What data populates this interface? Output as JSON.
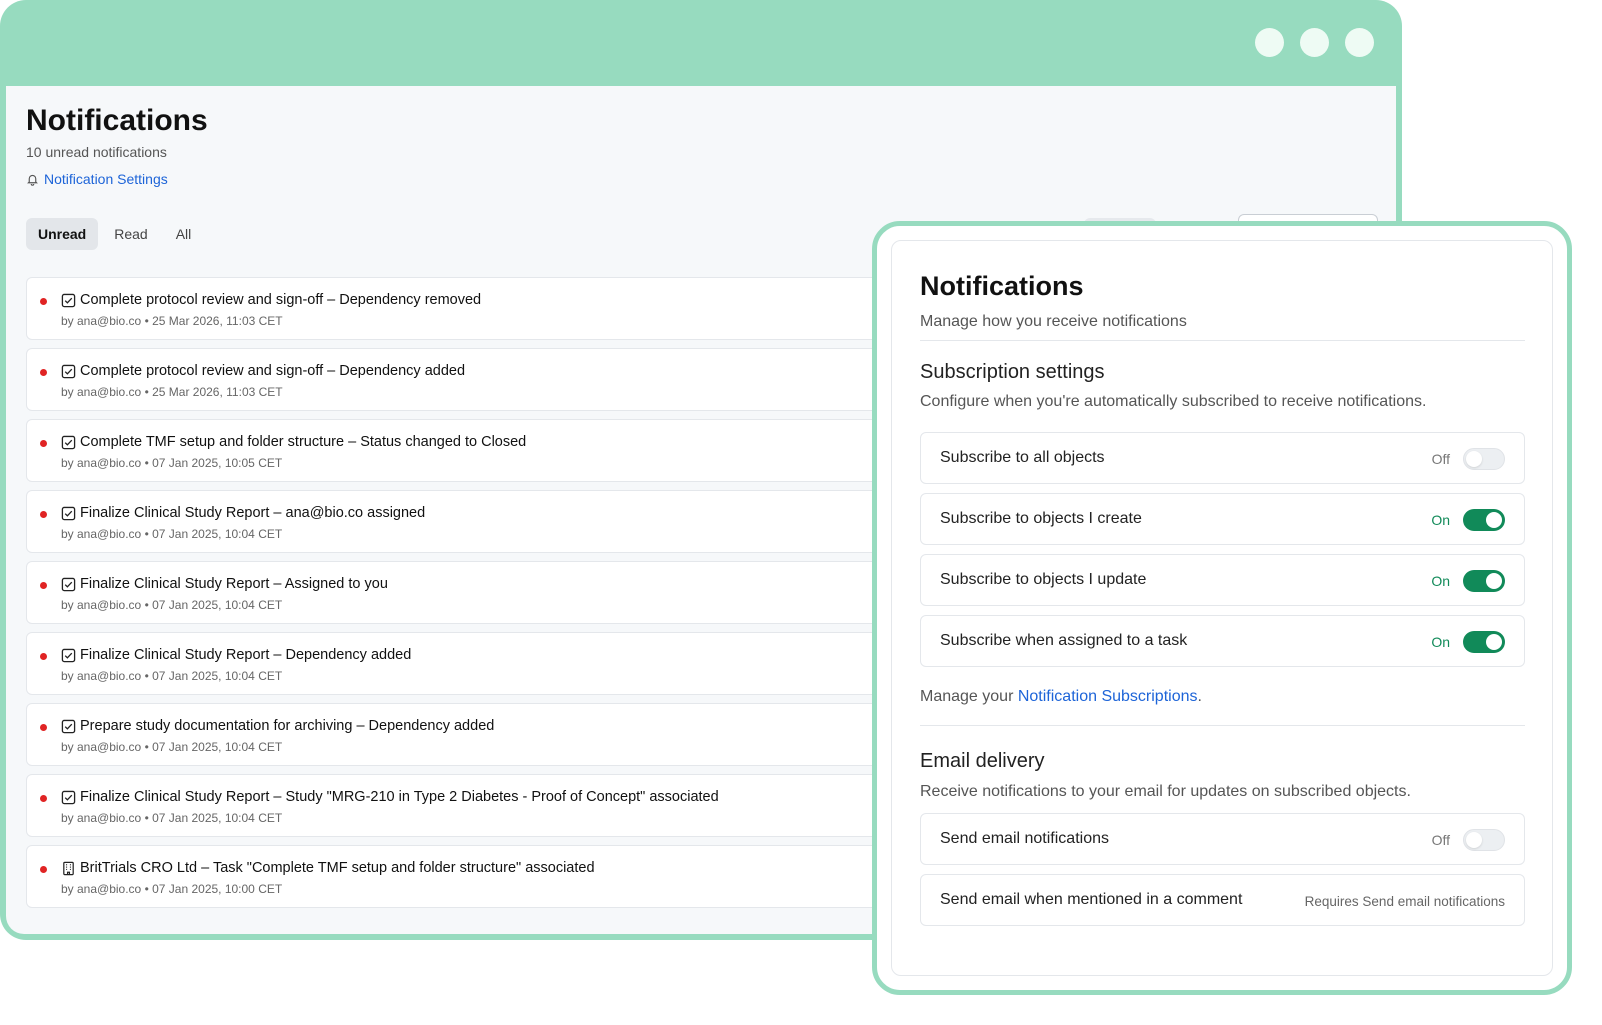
{
  "notifications_page": {
    "title": "Notifications",
    "unread_count_text": "10 unread notifications",
    "settings_link": "Notification Settings",
    "tabs": [
      {
        "label": "Unread"
      },
      {
        "label": "Read"
      },
      {
        "label": "All"
      }
    ],
    "items": [
      {
        "title": "Complete protocol review and sign-off – Dependency removed",
        "meta": "by ana@bio.co • 25 Mar 2026, 11:03 CET",
        "icon": "task-checkbox-icon"
      },
      {
        "title": "Complete protocol review and sign-off – Dependency added",
        "meta": "by ana@bio.co • 25 Mar 2026, 11:03 CET",
        "icon": "task-checkbox-icon"
      },
      {
        "title": "Complete TMF setup and folder structure – Status changed to Closed",
        "meta": "by ana@bio.co • 07 Jan 2025, 10:05 CET",
        "icon": "task-checkbox-icon"
      },
      {
        "title": "Finalize Clinical Study Report – ana@bio.co assigned",
        "meta": "by ana@bio.co • 07 Jan 2025, 10:04 CET",
        "icon": "task-checkbox-icon"
      },
      {
        "title": "Finalize Clinical Study Report – Assigned to you",
        "meta": "by ana@bio.co • 07 Jan 2025, 10:04 CET",
        "icon": "task-checkbox-icon"
      },
      {
        "title": "Finalize Clinical Study Report – Dependency added",
        "meta": "by ana@bio.co • 07 Jan 2025, 10:04 CET",
        "icon": "task-checkbox-icon"
      },
      {
        "title": "Prepare study documentation for archiving – Dependency added",
        "meta": "by ana@bio.co • 07 Jan 2025, 10:04 CET",
        "icon": "task-checkbox-icon"
      },
      {
        "title": "Finalize Clinical Study Report – Study \"MRG-210 in Type 2 Diabetes - Proof of Concept\" associated",
        "meta": "by ana@bio.co • 07 Jan 2025, 10:04 CET",
        "icon": "task-checkbox-icon"
      },
      {
        "title": "BritTrials CRO Ltd – Task \"Complete TMF setup and folder structure\" associated",
        "meta": "by ana@bio.co • 07 Jan 2025, 10:00 CET",
        "icon": "building-icon"
      }
    ]
  },
  "settings_panel": {
    "title": "Notifications",
    "subtitle": "Manage how you receive notifications",
    "subscription": {
      "title": "Subscription settings",
      "description": "Configure when you're automatically subscribed to receive notifications.",
      "rows": [
        {
          "label": "Subscribe to all objects",
          "state": "Off"
        },
        {
          "label": "Subscribe to objects I create",
          "state": "On"
        },
        {
          "label": "Subscribe to objects I update",
          "state": "On"
        },
        {
          "label": "Subscribe when assigned to a task",
          "state": "On"
        }
      ],
      "manage_prefix": "Manage your ",
      "manage_link": "Notification Subscriptions",
      "manage_suffix": "."
    },
    "email": {
      "title": "Email delivery",
      "description": "Receive notifications to your email for updates on subscribed objects.",
      "rows": [
        {
          "label": "Send email notifications",
          "state": "Off"
        },
        {
          "label": "Send email when mentioned in a comment",
          "note": "Requires Send email notifications"
        }
      ]
    }
  },
  "colors": {
    "window_frame": "#97dbbf",
    "toggle_on": "#118a59",
    "unread_dot": "#e02424",
    "link": "#1d64d8"
  }
}
